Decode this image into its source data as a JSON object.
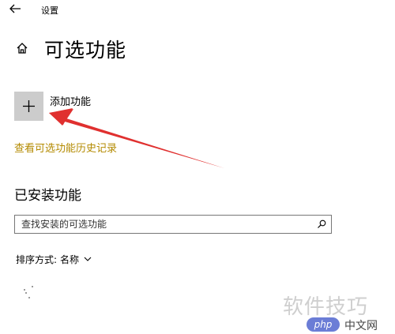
{
  "window": {
    "title": "设置"
  },
  "page": {
    "title": "可选功能"
  },
  "add_feature": {
    "label": "添加功能"
  },
  "history_link": {
    "label": "查看可选功能历史记录"
  },
  "installed": {
    "title": "已安装功能",
    "search_placeholder": "查找安装的可选功能",
    "sort_label": "排序方式:",
    "sort_value": "名称"
  },
  "watermark": {
    "text": "软件技巧",
    "logo": "php",
    "site": "中文网"
  },
  "colors": {
    "link": "#b38a00",
    "tile": "#cccccc",
    "arrow": "#e0302f"
  },
  "icons": [
    "back-arrow-icon",
    "home-icon",
    "plus-icon",
    "search-icon",
    "chevron-down-icon",
    "loading-dots-icon"
  ]
}
